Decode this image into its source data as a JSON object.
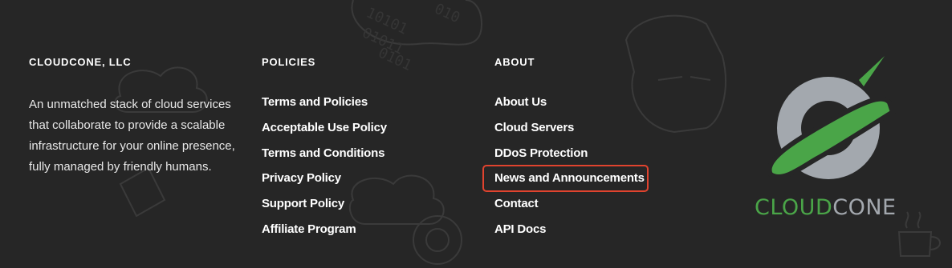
{
  "company": {
    "heading": "CLOUDCONE, LLC",
    "description": "An unmatched stack of cloud services that collaborate to provide a scalable infrastructure for your online presence, fully managed by friendly humans."
  },
  "policies": {
    "heading": "POLICIES",
    "links": [
      "Terms and Policies",
      "Acceptable Use Policy",
      "Terms and Conditions",
      "Privacy Policy",
      "Support Policy",
      "Affiliate Program"
    ]
  },
  "about": {
    "heading": "ABOUT",
    "links": [
      "About Us",
      "Cloud Servers",
      "DDoS Protection",
      "News and Announcements",
      "Contact",
      "API Docs"
    ],
    "highlighted_link": "News and Announcements"
  },
  "logo": {
    "text_part1": "CLOUD",
    "text_part2": "CONE",
    "colors": {
      "green": "#4aa548",
      "grey": "#a3a8ae"
    }
  },
  "theme": {
    "background": "#262626",
    "highlight_border": "#e0432e"
  }
}
